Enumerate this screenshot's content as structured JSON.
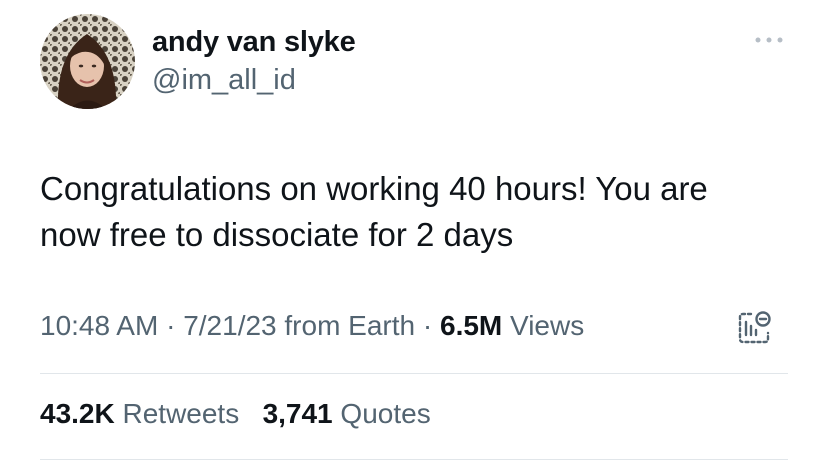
{
  "author": {
    "name": "andy van slyke",
    "handle": "@im_all_id"
  },
  "tweet": {
    "text": "Congratulations on working 40 hours! You are\nnow free to dissociate for 2 days"
  },
  "meta": {
    "time": "10:48 AM",
    "separator1": " · ",
    "date": "7/21/23",
    "source": " from Earth",
    "separator2": " · ",
    "views_count": "6.5M",
    "views_label": " Views"
  },
  "stats": {
    "retweets_count": "43.2K",
    "retweets_label": " Retweets",
    "quotes_count": "3,741",
    "quotes_label": " Quotes"
  },
  "icons": {
    "more": "more-dots-icon",
    "analytics": "analytics-icon"
  },
  "colors": {
    "text_primary": "#0f1419",
    "text_secondary": "#536471",
    "divider": "#e1e6ea"
  }
}
